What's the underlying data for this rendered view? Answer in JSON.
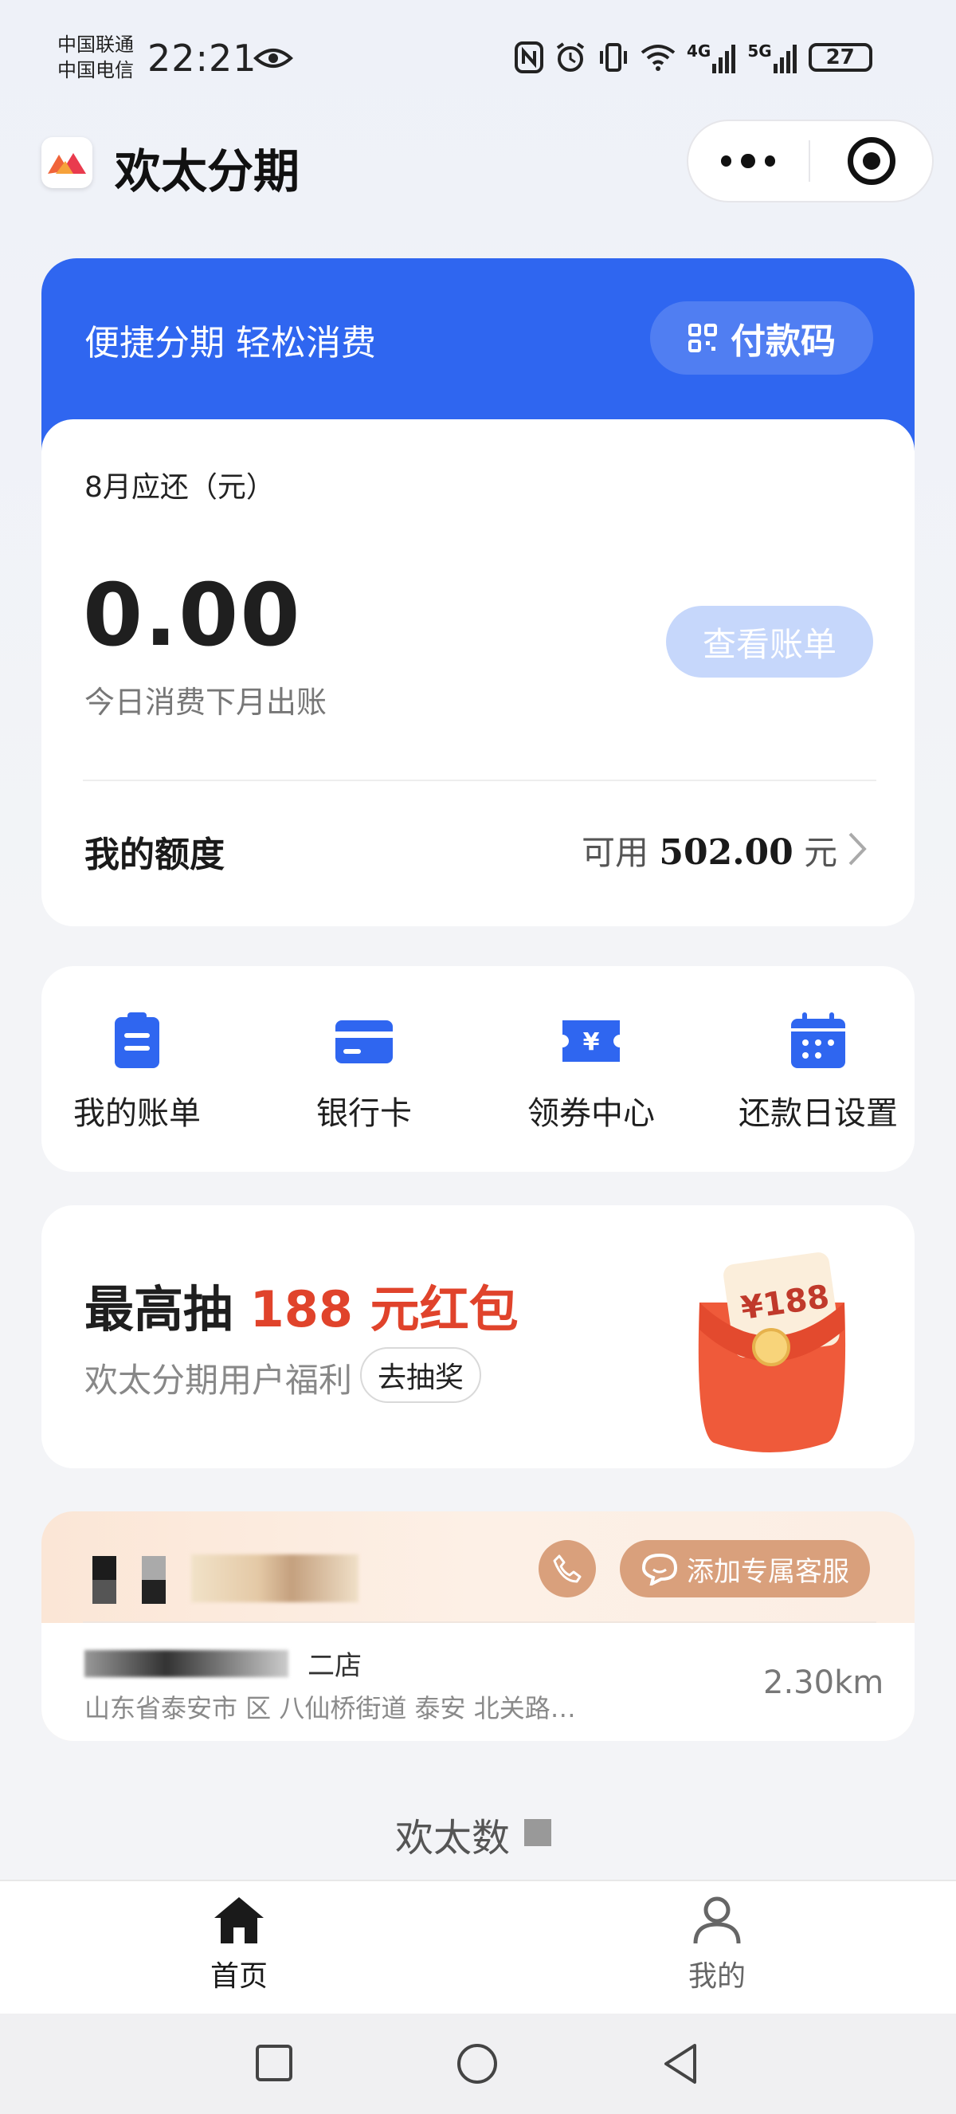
{
  "status_bar": {
    "carrier1": "中国联通",
    "carrier2": "中国电信",
    "time": "22:21",
    "network1": "4G",
    "network2": "5G",
    "battery": "27"
  },
  "header": {
    "title": "欢太分期"
  },
  "banner": {
    "slogan": "便捷分期 轻松消费",
    "paycode_label": "付款码"
  },
  "bill": {
    "label": "8月应还（元）",
    "amount": "0.00",
    "sub": "今日消费下月出账",
    "view_button": "查看账单",
    "quota_label": "我的额度",
    "quota_prefix": "可用",
    "quota_amount": "502.00",
    "quota_unit": "元"
  },
  "shortcuts": [
    {
      "label": "我的账单",
      "icon": "clipboard-icon"
    },
    {
      "label": "银行卡",
      "icon": "card-icon"
    },
    {
      "label": "领券中心",
      "icon": "coupon-icon"
    },
    {
      "label": "还款日设置",
      "icon": "calendar-icon"
    }
  ],
  "promo": {
    "title_prefix": "最高抽",
    "title_highlight": "188 元红包",
    "subtitle": "欢太分期用户福利",
    "button": "去抽奖",
    "envelope_value": "¥188"
  },
  "store": {
    "cs_button": "添加专属客服",
    "name_suffix": "二店",
    "address": "山东省泰安市   区 八仙桥街道 泰安     北关路…",
    "distance": "2.30km"
  },
  "section_title": "欢太数",
  "tabbar": [
    {
      "label": "首页",
      "active": true
    },
    {
      "label": "我的",
      "active": false
    }
  ],
  "colors": {
    "brand_blue": "#2f66f0",
    "promo_red": "#e0432b",
    "service_tan": "#d9a07c"
  }
}
